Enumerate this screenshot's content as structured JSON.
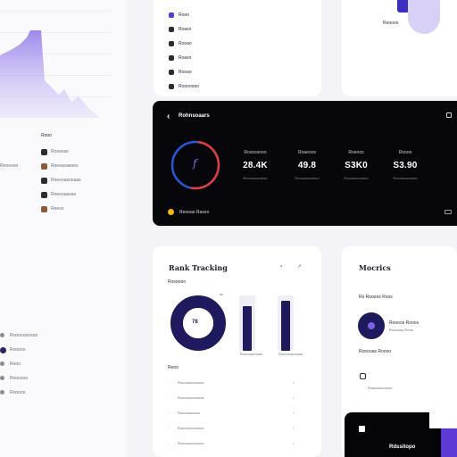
{
  "colors": {
    "accent": "#5b3ad6",
    "accent_light": "#b7a6f0",
    "navy": "#1f1a5e",
    "dark": "#07070b",
    "red": "#e23b3b",
    "blue": "#2a56d8",
    "yellow": "#f2b705"
  },
  "left": {
    "section_title": "Rooo",
    "list": [
      {
        "icon": "avatar-icon",
        "label": "Rosooas"
      },
      {
        "icon": "avatar-icon",
        "label": "Reesseaeoes"
      },
      {
        "icon": "avatar-icon",
        "label": "Roeooasonaas"
      },
      {
        "icon": "avatar-icon",
        "label": "Roeooaasas"
      },
      {
        "icon": "avatar-icon",
        "label": "Reeso"
      }
    ],
    "side_label": "Reooooo",
    "nav": [
      {
        "label": "Rooooooosoo"
      },
      {
        "label": "Rooooo"
      },
      {
        "label": "Rooo"
      },
      {
        "label": "Rooosoo"
      },
      {
        "label": "Rooooo"
      }
    ]
  },
  "top_list": {
    "items": [
      "Rooo",
      "Roaso",
      "Rooao",
      "Roaso",
      "Rooao",
      "Rooooooo"
    ]
  },
  "top_right": {
    "label": "Reoooo"
  },
  "hero": {
    "title": "Rohnsoaars",
    "ring_glyph": "f",
    "stats": [
      {
        "label": "Rooossooo",
        "value": "28.4K",
        "sub": "Roooosoooeoo"
      },
      {
        "label": "Roaeoos",
        "value": "49.8",
        "sub": "Roooosoooeoo"
      },
      {
        "label": "Roeoos",
        "value": "S3K0",
        "sub": "Roooosoooeoo"
      },
      {
        "label": "Roooo",
        "value": "S3.90",
        "sub": "Roooosoooeoo"
      }
    ],
    "footer_label": "Reooae Raseo"
  },
  "rank": {
    "title": "Rank Tracking",
    "sub_label": "Rosoooo",
    "donut_label": "78",
    "donut_tick": "ac",
    "donut_value": 0.78,
    "bars": [
      {
        "label": "Rooooooooso",
        "value": 0.8
      },
      {
        "label": "Roooooooooso",
        "value": 0.9
      }
    ],
    "list_title": "Reoo",
    "list": [
      {
        "label": "Roooooooooooo"
      },
      {
        "label": "Rooooooooooos"
      },
      {
        "label": "Roooooooooo"
      },
      {
        "label": "Roooooooooooo"
      },
      {
        "label": "Roooooooooooo"
      },
      {
        "label": "Roooooooooo"
      }
    ]
  },
  "metrics": {
    "title": "Mocrics",
    "subtitle": "Rs Roooos Roos",
    "item_label": "Roooos Rooos",
    "item_sub": "Roooooo Roos",
    "section": "Rooooas Roooo",
    "footer_label": "Roaooooooooo"
  },
  "bottom_dark": {
    "title": "Rdssitopo"
  }
}
